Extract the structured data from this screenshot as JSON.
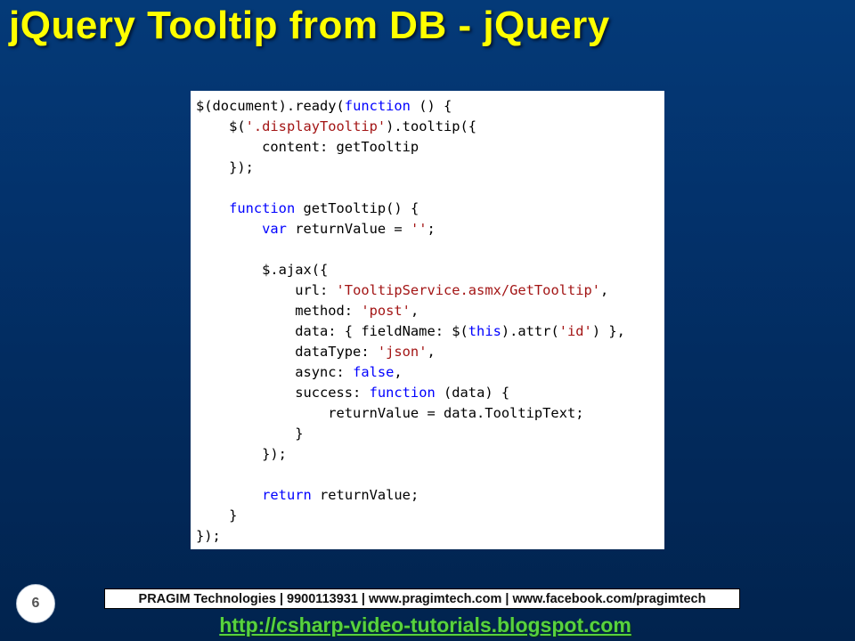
{
  "slide": {
    "title": "jQuery Tooltip from DB - jQuery",
    "page_number": "6"
  },
  "colors": {
    "background": "#03316a",
    "title": "#ffff00",
    "code_keyword": "#0000ff",
    "code_string": "#a31515",
    "link": "#57d23f"
  },
  "code": {
    "lines": [
      [
        {
          "t": "$(document).ready(",
          "k": "plain"
        },
        {
          "t": "function",
          "k": "keyword"
        },
        {
          "t": " () {",
          "k": "plain"
        }
      ],
      [
        {
          "t": "    $(",
          "k": "plain"
        },
        {
          "t": "'.displayTooltip'",
          "k": "string"
        },
        {
          "t": ").tooltip({",
          "k": "plain"
        }
      ],
      [
        {
          "t": "        content: getTooltip",
          "k": "plain"
        }
      ],
      [
        {
          "t": "    });",
          "k": "plain"
        }
      ],
      [
        {
          "t": "",
          "k": "plain"
        }
      ],
      [
        {
          "t": "    ",
          "k": "plain"
        },
        {
          "t": "function",
          "k": "keyword"
        },
        {
          "t": " getTooltip() {",
          "k": "plain"
        }
      ],
      [
        {
          "t": "        ",
          "k": "plain"
        },
        {
          "t": "var",
          "k": "keyword"
        },
        {
          "t": " returnValue = ",
          "k": "plain"
        },
        {
          "t": "''",
          "k": "string"
        },
        {
          "t": ";",
          "k": "plain"
        }
      ],
      [
        {
          "t": "",
          "k": "plain"
        }
      ],
      [
        {
          "t": "        $.ajax({",
          "k": "plain"
        }
      ],
      [
        {
          "t": "            url: ",
          "k": "plain"
        },
        {
          "t": "'TooltipService.asmx/GetTooltip'",
          "k": "string"
        },
        {
          "t": ",",
          "k": "plain"
        }
      ],
      [
        {
          "t": "            method: ",
          "k": "plain"
        },
        {
          "t": "'post'",
          "k": "string"
        },
        {
          "t": ",",
          "k": "plain"
        }
      ],
      [
        {
          "t": "            data: { fieldName: $(",
          "k": "plain"
        },
        {
          "t": "this",
          "k": "keyword"
        },
        {
          "t": ").attr(",
          "k": "plain"
        },
        {
          "t": "'id'",
          "k": "string"
        },
        {
          "t": ") },",
          "k": "plain"
        }
      ],
      [
        {
          "t": "            dataType: ",
          "k": "plain"
        },
        {
          "t": "'json'",
          "k": "string"
        },
        {
          "t": ",",
          "k": "plain"
        }
      ],
      [
        {
          "t": "            async: ",
          "k": "plain"
        },
        {
          "t": "false",
          "k": "keyword"
        },
        {
          "t": ",",
          "k": "plain"
        }
      ],
      [
        {
          "t": "            success: ",
          "k": "plain"
        },
        {
          "t": "function",
          "k": "keyword"
        },
        {
          "t": " (data) {",
          "k": "plain"
        }
      ],
      [
        {
          "t": "                returnValue = data.TooltipText;",
          "k": "plain"
        }
      ],
      [
        {
          "t": "            }",
          "k": "plain"
        }
      ],
      [
        {
          "t": "        });",
          "k": "plain"
        }
      ],
      [
        {
          "t": "",
          "k": "plain"
        }
      ],
      [
        {
          "t": "        ",
          "k": "plain"
        },
        {
          "t": "return",
          "k": "keyword"
        },
        {
          "t": " returnValue;",
          "k": "plain"
        }
      ],
      [
        {
          "t": "    }",
          "k": "plain"
        }
      ],
      [
        {
          "t": "});",
          "k": "plain"
        }
      ]
    ]
  },
  "footer": {
    "banner": "PRAGIM Technologies | 9900113931 | www.pragimtech.com | www.facebook.com/pragimtech",
    "link": "http://csharp-video-tutorials.blogspot.com"
  }
}
